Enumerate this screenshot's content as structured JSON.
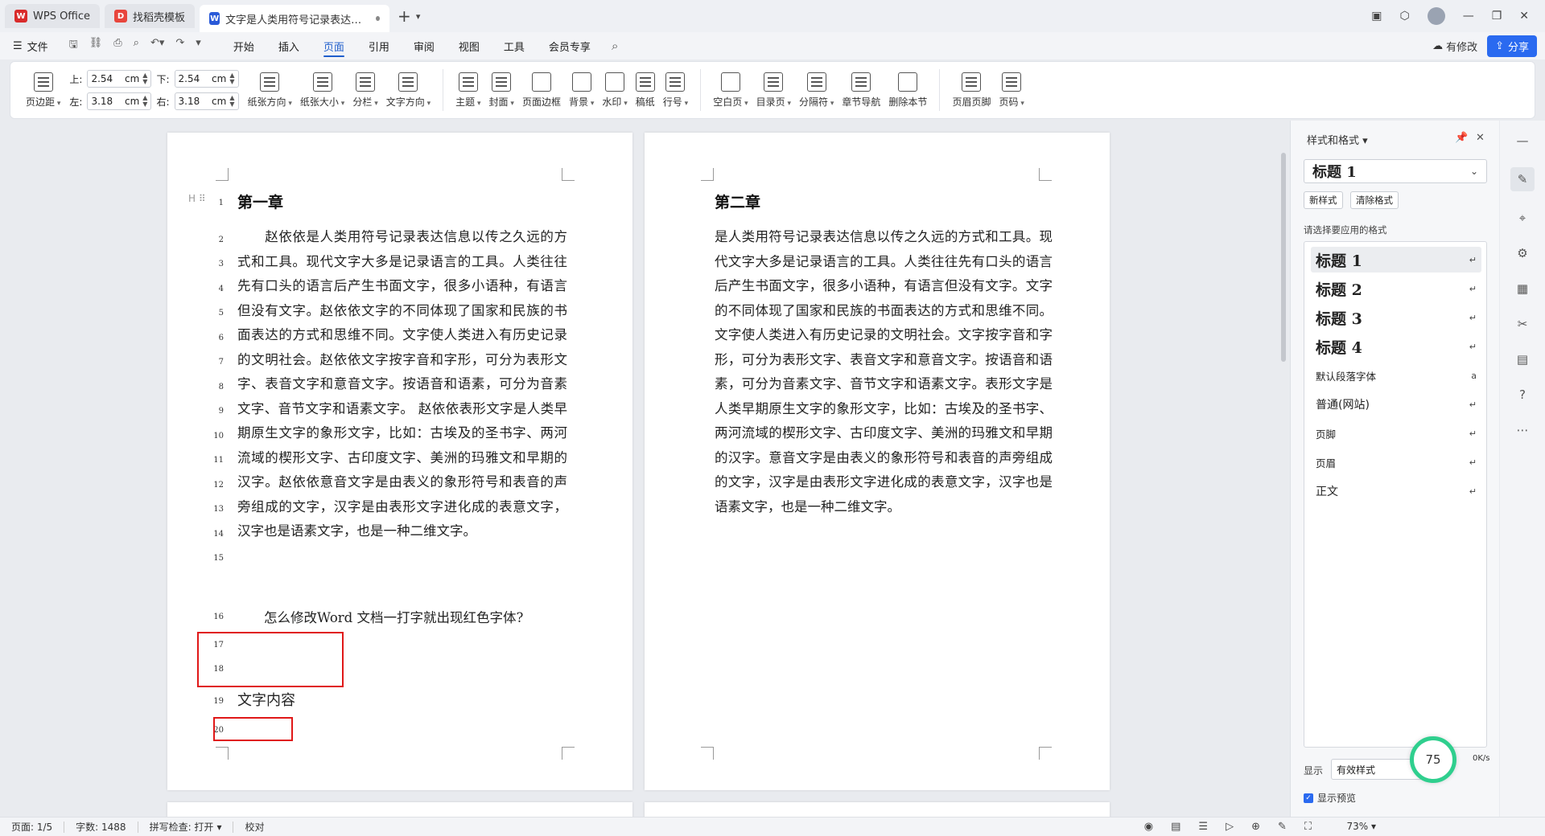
{
  "titlebar": {
    "tabs": [
      {
        "label": "WPS Office",
        "icon": "wps-logo-icon",
        "color": "#d92b2b"
      },
      {
        "label": "找稻壳模板",
        "icon": "docer-icon",
        "color": "#e8453c"
      },
      {
        "label": "文字是人类用符号记录表达信息以传之久远的方式和工具",
        "icon": "writer-icon",
        "color": "#2a5ad8"
      }
    ],
    "new_tab": "+",
    "more": "▾"
  },
  "menubar": {
    "file": "文件",
    "items": [
      "开始",
      "插入",
      "页面",
      "引用",
      "审阅",
      "视图",
      "工具",
      "会员专享"
    ],
    "active": "页面",
    "modify": "有修改",
    "share": "分享"
  },
  "ribbon": {
    "margins_label": "页边距",
    "top_label": "上:",
    "top_value": "2.54",
    "bottom_label": "下:",
    "bottom_value": "2.54",
    "left_label": "左:",
    "left_value": "3.18",
    "right_label": "右:",
    "right_value": "3.18",
    "unit": "cm",
    "group1": [
      "纸张方向",
      "纸张大小",
      "分栏",
      "文字方向"
    ],
    "group2": [
      "主题",
      "封面",
      "页面边框",
      "背景",
      "水印",
      "稿纸",
      "行号"
    ],
    "group3": [
      "空白页",
      "目录页",
      "分隔符",
      "章节导航",
      "删除本节"
    ],
    "group4": [
      "页眉页脚",
      "页码"
    ]
  },
  "page1": {
    "chapter": "第一章",
    "paragraph": "　　赵依依是人类用符号记录表达信息以传之久远的方式和工具。现代文字大多是记录语言的工具。人类往往先有口头的语言后产生书面文字，很多小语种，有语言但没有文字。赵依依文字的不同体现了国家和民族的书面表达的方式和思维不同。文字使人类进入有历史记录的文明社会。赵依依文字按字音和字形，可分为表形文字、表音文字和意音文字。按语音和语素，可分为音素文字、音节文字和语素文字。 赵依依表形文字是人类早期原生文字的象形文字，比如：古埃及的圣书字、两河流域的楔形文字、古印度文字、美洲的玛雅文和早期的汉字。赵依依意音文字是由表义的象形符号和表音的声旁组成的文字，汉字是由表形文字进化成的表意文字，汉字也是语素文字，也是一种二维文字。",
    "question": "　　怎么修改Word 文档一打字就出现红色字体?",
    "content_line": "文字内容",
    "line_numbers": [
      "1",
      "2",
      "3",
      "4",
      "5",
      "6",
      "7",
      "8",
      "9",
      "10",
      "11",
      "12",
      "13",
      "14",
      "15",
      "16",
      "17",
      "18",
      "19",
      "20"
    ]
  },
  "page2": {
    "chapter": "第二章",
    "paragraph": "是人类用符号记录表达信息以传之久远的方式和工具。现代文字大多是记录语言的工具。人类往往先有口头的语言后产生书面文字，很多小语种，有语言但没有文字。文字的不同体现了国家和民族的书面表达的方式和思维不同。文字使人类进入有历史记录的文明社会。文字按字音和字形，可分为表形文字、表音文字和意音文字。按语音和语素，可分为音素文字、音节文字和语素文字。表形文字是人类早期原生文字的象形文字，比如：古埃及的圣书字、两河流域的楔形文字、古印度文字、美洲的玛雅文和早期的汉字。意音文字是由表义的象形符号和表音的声旁组成的文字，汉字是由表形文字进化成的表意文字，汉字也是语素文字，也是一种二维文字。"
  },
  "panel": {
    "title": "样式和格式",
    "current_style": "标题 1",
    "new_style": "新样式",
    "clear_format": "清除格式",
    "hint": "请选择要应用的格式",
    "styles": [
      {
        "name": "标题 1",
        "kind": "h"
      },
      {
        "name": "标题 2",
        "kind": "h"
      },
      {
        "name": "标题 3",
        "kind": "h"
      },
      {
        "name": "标题 4",
        "kind": "h"
      },
      {
        "name": "默认段落字体",
        "kind": "s"
      },
      {
        "name": "普通(网站)",
        "kind": "n"
      },
      {
        "name": "页脚",
        "kind": "s"
      },
      {
        "name": "页眉",
        "kind": "s"
      },
      {
        "name": "正文",
        "kind": "n"
      }
    ],
    "display_label": "显示",
    "display_value": "有效样式",
    "preview_label": "显示预览",
    "badge": "75",
    "speed": "0K/s"
  },
  "statusbar": {
    "page": "页面: 1/5",
    "words": "字数: 1488",
    "spell": "拼写检查: 打开",
    "proof": "校对",
    "zoom": "73%"
  },
  "colors": {
    "accent": "#1f5ecc",
    "share": "#2a6af0",
    "highlight": "#e01818"
  }
}
